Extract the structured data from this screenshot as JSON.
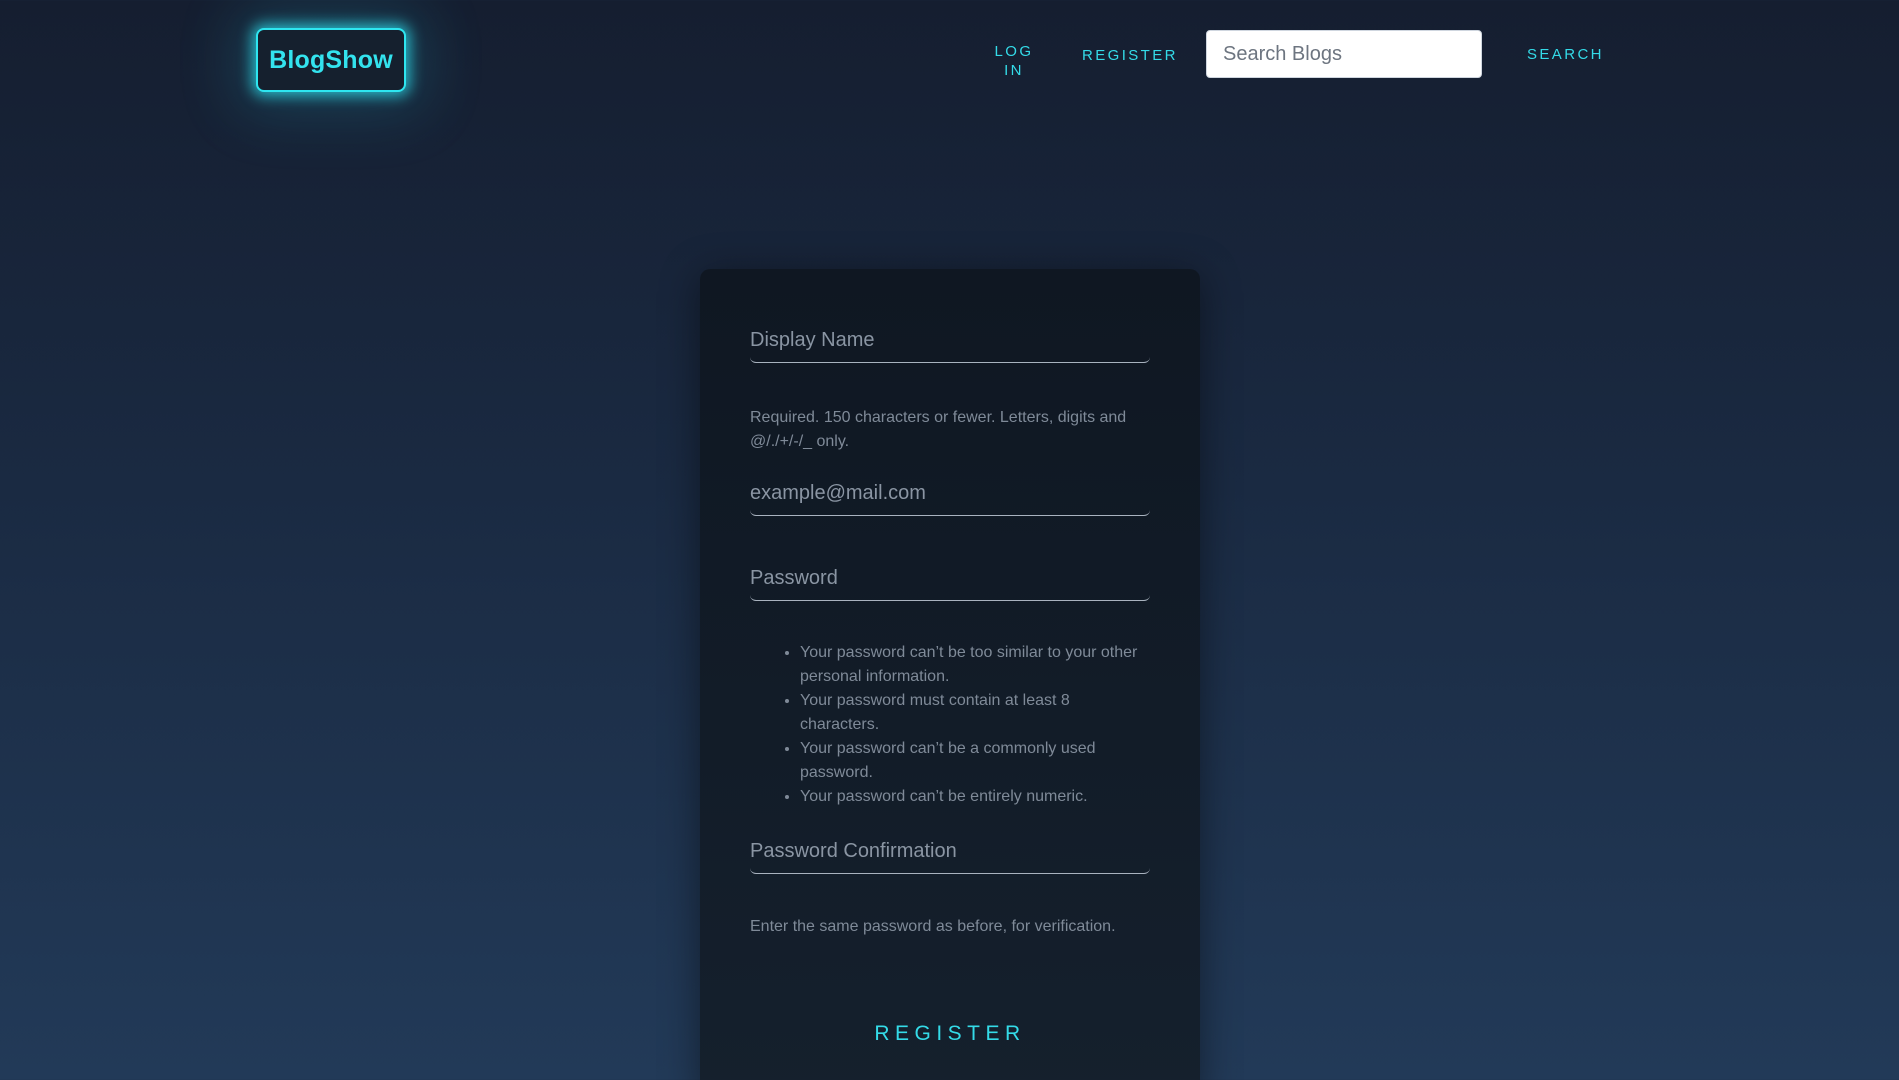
{
  "header": {
    "logo": "BlogShow",
    "nav": {
      "login": "LOG IN",
      "register": "REGISTER",
      "search_placeholder": "Search Blogs",
      "search_button": "SEARCH"
    }
  },
  "form": {
    "display_name_placeholder": "Display Name",
    "display_name_help": "Required. 150 characters or fewer. Letters, digits and @/./+/-/_ only.",
    "email_placeholder": "example@mail.com",
    "password_placeholder": "Password",
    "password_rules": [
      "Your password can’t be too similar to your other personal information.",
      "Your password must contain at least 8 characters.",
      "Your password can’t be a commonly used password.",
      "Your password can’t be entirely numeric."
    ],
    "password_confirm_placeholder": "Password Confirmation",
    "password_confirm_help": "Enter the same password as before, for verification.",
    "submit_label": "REGISTER"
  },
  "colors": {
    "accent": "#34dbe8",
    "background_top": "#151e30",
    "background_bottom": "#223a58",
    "card": "#0f1722",
    "muted_text": "#7f8a98"
  }
}
